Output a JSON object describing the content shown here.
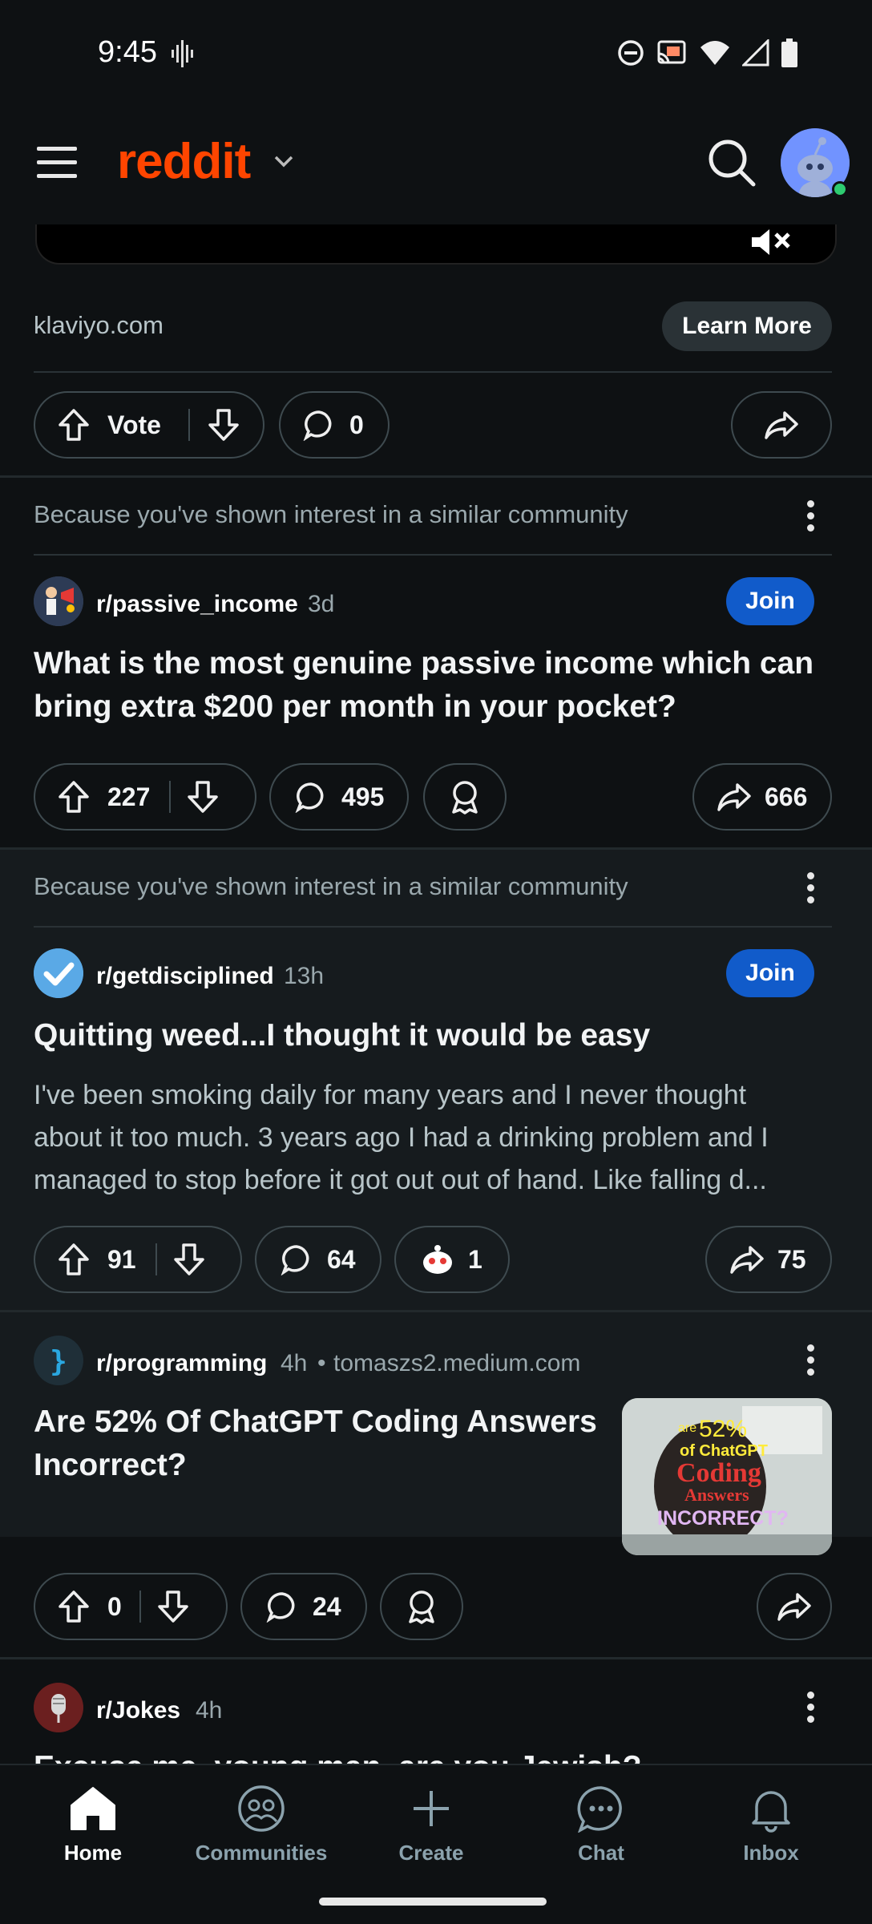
{
  "status_bar": {
    "time": "9:45"
  },
  "header": {
    "logo": "reddit"
  },
  "ad": {
    "domain": "klaviyo.com",
    "cta": "Learn More",
    "vote_label": "Vote",
    "comments": "0"
  },
  "posts": [
    {
      "reason": "Because you've shown interest in a similar community",
      "subreddit": "r/passive_income",
      "age": "3d",
      "join": "Join",
      "title_line1": "What is the most genuine passive income which can",
      "title_line2": "bring extra $200 per month in your pocket?",
      "votes": "227",
      "comments": "495",
      "shares": "666"
    },
    {
      "reason": "Because you've shown interest in a similar community",
      "subreddit": "r/getdisciplined",
      "age": "13h",
      "join": "Join",
      "title_line1": "Quitting weed...I thought it would be easy",
      "body_line1": "I've been smoking daily for many years and I never thought",
      "body_line2": "about it too much. 3 years ago I had a drinking problem and I",
      "body_line3": "managed to stop before it got out out of hand. Like falling d...",
      "votes": "91",
      "comments": "64",
      "awards": "1",
      "shares": "75"
    },
    {
      "subreddit": "r/programming",
      "age": "4h",
      "domain": "tomaszs2.medium.com",
      "title_line1": "Are 52% Of ChatGPT Coding Answers",
      "title_line2": "Incorrect?",
      "votes": "0",
      "comments": "24",
      "thumb_text": {
        "a": "are",
        "b": "52%",
        "c": "of ChatGPT",
        "d": "Coding",
        "e": "Answers",
        "f": "INCORRECT?"
      }
    },
    {
      "subreddit": "r/Jokes",
      "age": "4h",
      "title_partial": "Excuse me, young man, are you Jewish?"
    }
  ],
  "bottom_nav": [
    {
      "label": "Home",
      "icon": "home-icon",
      "active": true
    },
    {
      "label": "Communities",
      "icon": "communities-icon"
    },
    {
      "label": "Create",
      "icon": "plus-icon"
    },
    {
      "label": "Chat",
      "icon": "chat-icon"
    },
    {
      "label": "Inbox",
      "icon": "bell-icon"
    }
  ],
  "colors": {
    "brand": "#ff4500",
    "join": "#115bca",
    "background": "#0e1113"
  }
}
